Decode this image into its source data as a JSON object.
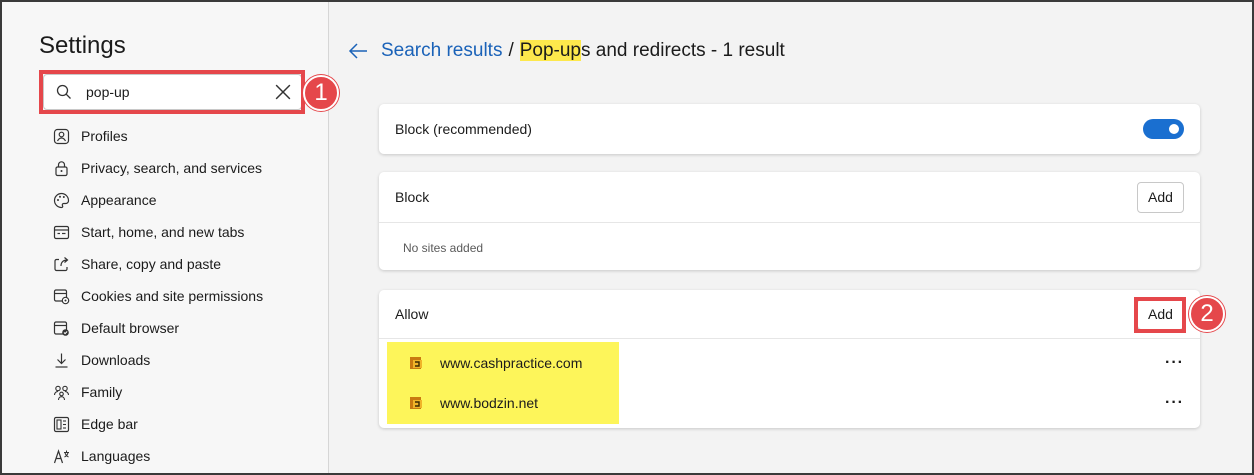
{
  "sidebar": {
    "title": "Settings",
    "search": {
      "value": "pop-up",
      "icon": "search-icon"
    },
    "items": [
      {
        "label": "Profiles",
        "icon": "profile-icon"
      },
      {
        "label": "Privacy, search, and services",
        "icon": "lock-icon"
      },
      {
        "label": "Appearance",
        "icon": "palette-icon"
      },
      {
        "label": "Start, home, and new tabs",
        "icon": "home-tabs-icon"
      },
      {
        "label": "Share, copy and paste",
        "icon": "share-icon"
      },
      {
        "label": "Cookies and site permissions",
        "icon": "cookies-icon"
      },
      {
        "label": "Default browser",
        "icon": "browser-icon"
      },
      {
        "label": "Downloads",
        "icon": "download-icon"
      },
      {
        "label": "Family",
        "icon": "family-icon"
      },
      {
        "label": "Edge bar",
        "icon": "edge-bar-icon"
      },
      {
        "label": "Languages",
        "icon": "languages-icon"
      }
    ]
  },
  "annotations": {
    "badge1": "1",
    "badge2": "2"
  },
  "header": {
    "link": "Search results",
    "separator": "/",
    "title_highlight": "Pop-up",
    "title_rest": "s and redirects - 1 result"
  },
  "block_recommended": {
    "label": "Block (recommended)",
    "enabled": true
  },
  "block": {
    "label": "Block",
    "add_label": "Add",
    "empty": "No sites added"
  },
  "allow": {
    "label": "Allow",
    "add_label": "Add",
    "sites": [
      {
        "url": "www.cashpractice.com",
        "more": "···"
      },
      {
        "url": "www.bodzin.net",
        "more": "···"
      }
    ]
  },
  "colors": {
    "accent": "#1a6fd0",
    "link": "#1a62b8",
    "annotation": "#e5474b",
    "highlight": "#fde84c"
  }
}
